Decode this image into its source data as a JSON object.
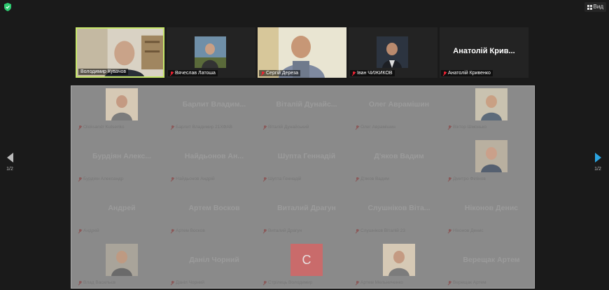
{
  "view_label": "Вид",
  "top_tiles": [
    {
      "name": "Володимир Кувачов",
      "muted": false,
      "type": "video",
      "active": true
    },
    {
      "name": "Вячеслав Латоша",
      "muted": true,
      "type": "thumb"
    },
    {
      "name": "Сергій Дереза",
      "muted": true,
      "type": "video"
    },
    {
      "name": "Іван ЧИЖИКОВ",
      "muted": true,
      "type": "thumb"
    },
    {
      "name": "Анатолій Кривенко",
      "muted": true,
      "type": "text",
      "big": "Анатолій Крив..."
    }
  ],
  "gallery": {
    "cells": [
      {
        "big": "",
        "sub": "Oleksandr Kutsenko",
        "kind": "thumb"
      },
      {
        "big": "Барлит Владим...",
        "sub": "Барлит Владимир 21ХФАВ",
        "kind": "text"
      },
      {
        "big": "Віталій Дунайс...",
        "sub": "Віталій Дунайський",
        "kind": "text"
      },
      {
        "big": "Олег Аврамішин",
        "sub": "Олег Аврамішин",
        "kind": "text"
      },
      {
        "big": "",
        "sub": "Віктор Шмонько",
        "kind": "thumb"
      },
      {
        "big": "Бурдіян Алекс...",
        "sub": "Бурдіян Александр",
        "kind": "text"
      },
      {
        "big": "Найдьонов Ан...",
        "sub": "Найдьонов Андрій",
        "kind": "text"
      },
      {
        "big": "Шупта Геннадій",
        "sub": "Шупта Геннадій",
        "kind": "text"
      },
      {
        "big": "Д'яков Вадим",
        "sub": "Д'яков Вадим",
        "kind": "text"
      },
      {
        "big": "",
        "sub": "Дмитро Філінов",
        "kind": "thumb"
      },
      {
        "big": "Андрей",
        "sub": "Андрей",
        "kind": "text"
      },
      {
        "big": "Артем Восков",
        "sub": "Артем Восков",
        "kind": "text"
      },
      {
        "big": "Виталий Драгун",
        "sub": "Виталий Драгун",
        "kind": "text"
      },
      {
        "big": "Слушніков Віта...",
        "sub": "Слушніков Віталій 23",
        "kind": "text"
      },
      {
        "big": "Ніконов Денис",
        "sub": "Ніконов Денис",
        "kind": "text"
      },
      {
        "big": "",
        "sub": "Влад Васильєв",
        "kind": "thumb"
      },
      {
        "big": "Даніл Чорний",
        "sub": "Даніл Чорний",
        "kind": "text"
      },
      {
        "big": "",
        "sub": "Стрілець Володимир",
        "kind": "badge",
        "badge": "C"
      },
      {
        "big": "",
        "sub": "Артем Мельниченко",
        "kind": "thumb"
      },
      {
        "big": "Верещак Артем",
        "sub": "Верещак Артем",
        "kind": "text"
      }
    ]
  },
  "pagination": {
    "left": "1/2",
    "right": "1/2"
  },
  "colors": {
    "active_border": "#c7e86a",
    "next_arrow": "#2ba4e0",
    "shield": "#2ecc71"
  }
}
